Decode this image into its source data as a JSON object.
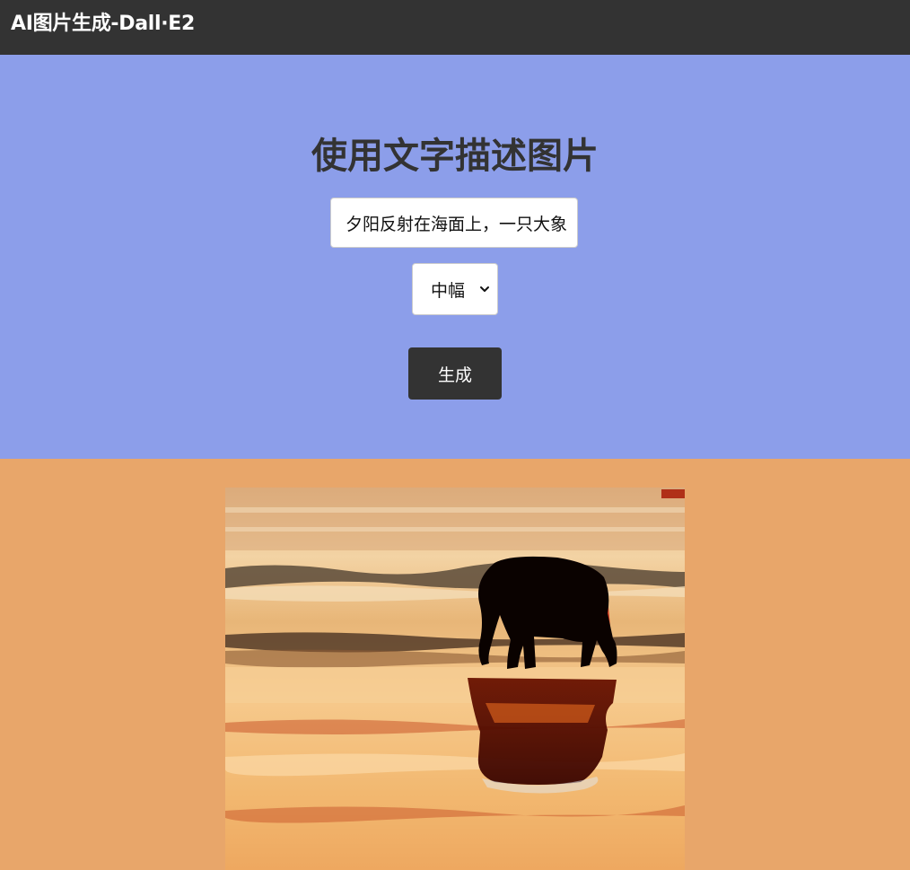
{
  "header": {
    "brand": "AI图片生成-Dall·E2"
  },
  "showcase": {
    "heading": "使用文字描述图片",
    "prompt_value": "夕阳反射在海面上，一只大象",
    "size_select": {
      "selected": "中幅"
    },
    "generate_label": "生成"
  },
  "result": {
    "image_alt": "elephant silhouette at sunset on the beach"
  },
  "colors": {
    "navbar": "#333333",
    "showcase_bg": "#8c9eea",
    "result_bg": "#e8a66a",
    "button_bg": "#333333"
  }
}
